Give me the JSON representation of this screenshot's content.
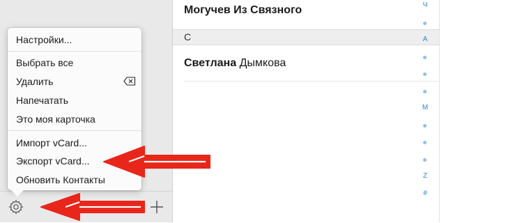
{
  "menu": {
    "groups": [
      {
        "items": [
          {
            "label": "Настройки..."
          }
        ]
      },
      {
        "items": [
          {
            "label": "Выбрать все"
          },
          {
            "label": "Удалить",
            "shortcut_icon": "delete-key-icon"
          },
          {
            "label": "Напечатать"
          },
          {
            "label": "Это моя карточка"
          }
        ]
      },
      {
        "items": [
          {
            "label": "Импорт vCard..."
          },
          {
            "label": "Экспорт vCard..."
          },
          {
            "label": "Обновить Контакты"
          }
        ]
      }
    ]
  },
  "toolbar": {
    "gear_icon": "gear-icon",
    "add_icon": "plus-icon"
  },
  "contacts": {
    "top_contact": {
      "bold": "Могучев Из Связного",
      "rest": ""
    },
    "section_letter": "С",
    "contact": {
      "first": "Светлана",
      "last": "Дымкова"
    }
  },
  "alphabet_index": [
    {
      "type": "letter",
      "text": "Ч"
    },
    {
      "type": "dot"
    },
    {
      "type": "letter",
      "text": "А"
    },
    {
      "type": "dot"
    },
    {
      "type": "dot"
    },
    {
      "type": "dot"
    },
    {
      "type": "letter",
      "text": "М"
    },
    {
      "type": "dot"
    },
    {
      "type": "dot"
    },
    {
      "type": "dot"
    },
    {
      "type": "letter",
      "text": "Z"
    },
    {
      "type": "letter",
      "text": "#"
    }
  ],
  "annotations": {
    "arrow_color": "#e8261a",
    "accent_blue": "#2f7fd9"
  }
}
